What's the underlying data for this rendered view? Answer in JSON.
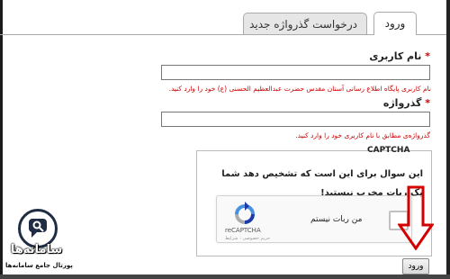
{
  "tabs": {
    "login": "ورود",
    "request_password": "درخواست گذرواژه جدید"
  },
  "form": {
    "username_label": "نام کاربری",
    "username_hint": "نام کاربری پایگاه اطلاع رسانی آستان مقدس حضرت عبدالعظیم الحسنی (ع) خود را وارد کنید.",
    "username_value": "",
    "password_label": "گذرواژه",
    "password_hint": "گذرواژه‌ی مطابق با نام کاربری خود را وارد کنید.",
    "password_value": "",
    "required_mark": "*"
  },
  "captcha": {
    "heading": "CAPTCHA",
    "question": "این سوال برای این است که تشخیص دهد شما یک ربات مخرب نیستید!",
    "checkbox_label": "من ربات نیستم",
    "brand": "reCAPTCHA",
    "terms": "حریم خصوصی - شرایط"
  },
  "submit_label": "ورود",
  "watermark": {
    "title": "سامانه‌ها",
    "subtitle": "پورتال جامع سامانه‌ها"
  },
  "colors": {
    "required": "#d00000",
    "hint": "#cc0000",
    "arrow": "#d40000"
  },
  "icons": {
    "recaptcha": "recaptcha-logo-icon",
    "arrow": "down-arrow-icon",
    "watermark": "chat-search-logo-icon"
  }
}
